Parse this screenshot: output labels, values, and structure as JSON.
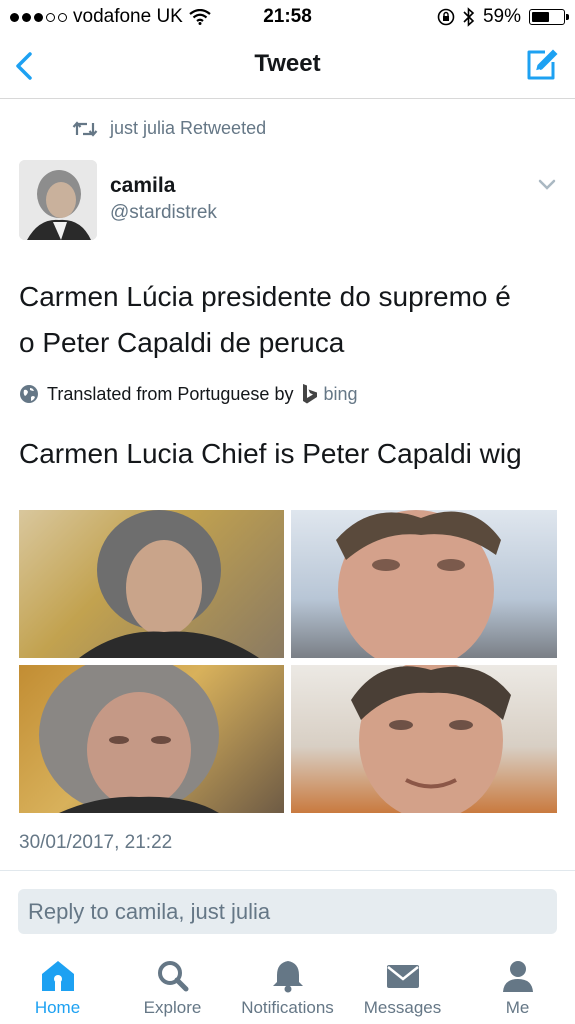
{
  "status_bar": {
    "carrier": "vodafone UK",
    "time": "21:58",
    "battery_percent": "59%",
    "battery_level": 0.59,
    "signal_bars_filled": 3,
    "signal_bars_total": 5
  },
  "nav": {
    "title": "Tweet",
    "back_icon": "chevron-left-icon",
    "compose_icon": "compose-icon"
  },
  "tweet": {
    "retweeted_by": "just julia Retweeted",
    "author_name": "camila",
    "author_handle": "@stardistrek",
    "text_line1": "Carmen Lúcia presidente do supremo é",
    "text_line2": "o Peter Capaldi de peruca",
    "translated_label": "Translated from Portuguese by",
    "translator": "bing",
    "translation": "Carmen Lucia Chief is Peter Capaldi wig",
    "timestamp": "30/01/2017, 21:22",
    "photo_count": 4
  },
  "reply": {
    "placeholder": "Reply to camila, just julia"
  },
  "tabs": [
    {
      "label": "Home",
      "icon": "home-icon",
      "active": true
    },
    {
      "label": "Explore",
      "icon": "search-icon",
      "active": false
    },
    {
      "label": "Notifications",
      "icon": "bell-icon",
      "active": false
    },
    {
      "label": "Messages",
      "icon": "envelope-icon",
      "active": false
    },
    {
      "label": "Me",
      "icon": "person-icon",
      "active": false
    }
  ],
  "colors": {
    "accent": "#1da1f2",
    "secondary_text": "#657786",
    "primary_text": "#14171a"
  }
}
